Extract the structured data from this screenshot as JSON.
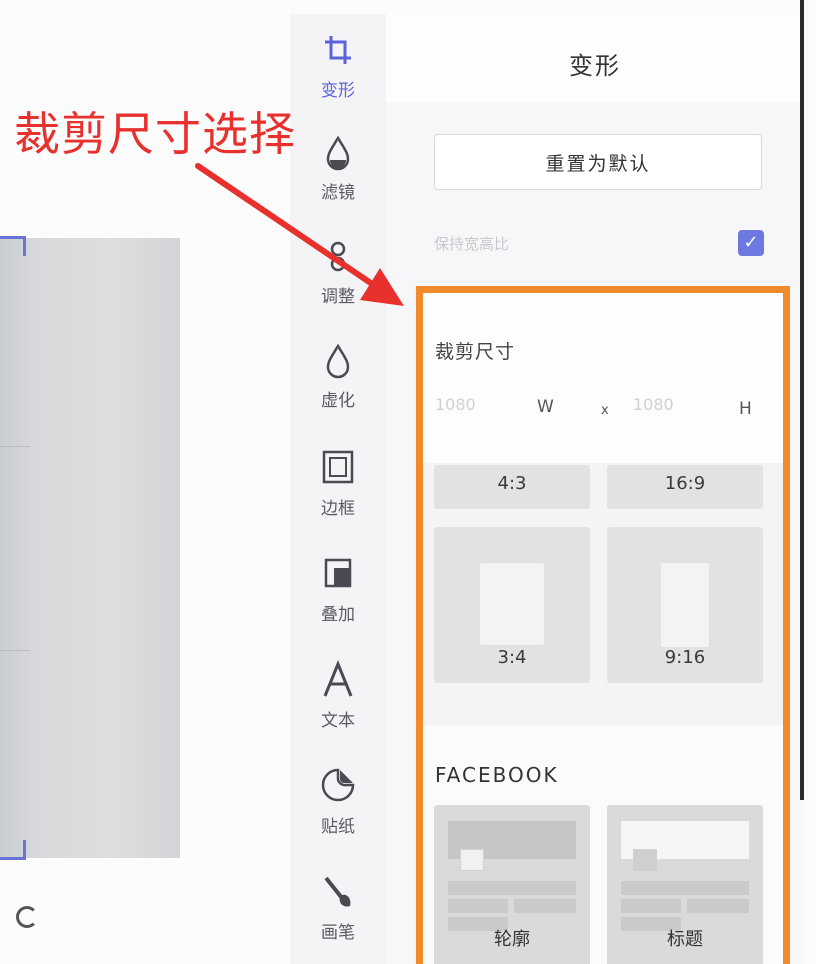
{
  "annotation": {
    "text": "裁剪尺寸选择",
    "color": "#e8302c"
  },
  "toolbar": {
    "accent": "#5b63d6",
    "items": [
      {
        "label": "变形",
        "icon": "crop-icon",
        "active": true
      },
      {
        "label": "滤镜",
        "icon": "filter-drop-icon"
      },
      {
        "label": "调整",
        "icon": "adjust-icon"
      },
      {
        "label": "虚化",
        "icon": "blur-drop-icon"
      },
      {
        "label": "边框",
        "icon": "frame-icon"
      },
      {
        "label": "叠加",
        "icon": "overlay-icon"
      },
      {
        "label": "文本",
        "icon": "text-icon"
      },
      {
        "label": "贴纸",
        "icon": "sticker-icon"
      },
      {
        "label": "画笔",
        "icon": "brush-icon"
      }
    ]
  },
  "panel": {
    "title": "变形",
    "reset_label": "重置为默认",
    "setting_label": "保持宽高比",
    "setting_checked": true,
    "crop": {
      "heading": "裁剪尺寸",
      "width_value": "1080",
      "width_unit": "W",
      "separator": "x",
      "height_value": "1080",
      "height_unit": "H",
      "ratios": [
        "4:3",
        "16:9",
        "3:4",
        "9:16"
      ]
    },
    "facebook": {
      "heading": "FACEBOOK",
      "cards": [
        "轮廓",
        "标题"
      ]
    }
  },
  "colors": {
    "highlight": "#f08a2a",
    "checkbox": "#6d79e0"
  }
}
